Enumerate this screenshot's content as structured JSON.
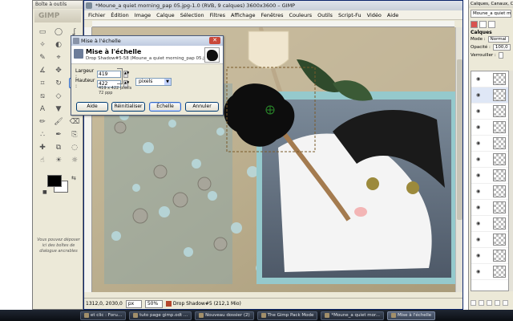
{
  "gimp": {
    "title": "*Moune_a quiet morning_pap 05.jpg-1.0 (RVB, 9 calques) 3600x3600 – GIMP",
    "menu": [
      "Fichier",
      "Édition",
      "Image",
      "Calque",
      "Sélection",
      "Filtres",
      "Affichage",
      "Fenêtres",
      "Couleurs",
      "Outils",
      "Script-Fu",
      "Vidéo",
      "Aide"
    ],
    "status": {
      "coords": "1312,0, 2030,0",
      "unit": "px",
      "zoom": "50%",
      "layer": "Drop Shadow#5 (212,1 Mio)"
    }
  },
  "toolbox": {
    "title": "Boîte à outils",
    "logo": "GIMP",
    "hint": "Vous pouvez déposer ici des boîtes de dialogue ancrables",
    "tools": [
      "rect-select-icon",
      "ellipse-select-icon",
      "lasso-icon",
      "magic-wand-icon",
      "select-by-color-icon",
      "scissors-icon",
      "paths-icon",
      "color-picker-icon",
      "zoom-icon",
      "measure-icon",
      "move-icon",
      "align-icon",
      "crop-icon",
      "rotate-icon",
      "scale-icon",
      "shear-icon",
      "perspective-icon",
      "flip-icon",
      "text-icon",
      "bucket-icon",
      "gradient-icon",
      "pencil-icon",
      "brush-icon",
      "eraser-icon",
      "airbrush-icon",
      "ink-icon",
      "clone-icon",
      "heal-icon",
      "perspective-clone-icon",
      "blur-icon",
      "smudge-icon",
      "dodge-icon",
      "dodge2-icon"
    ],
    "active_tool": "scale-icon",
    "fg_color": "#000000",
    "bg_color": "#ffffff"
  },
  "dialog": {
    "window_title": "Mise à l'échelle",
    "heading": "Mise à l'échelle",
    "subtitle": "Drop Shadow#5-58 (Moune_a quiet morning_pap 05.jpg)",
    "width_label": "Largeur :",
    "width_value": "419",
    "height_label": "Hauteur :",
    "height_value": "422",
    "unit": "pixels",
    "info_size": "419 x 422 pixels",
    "info_res": "72 ppp",
    "buttons": {
      "help": "Aide",
      "reset": "Réinitialiser",
      "scale": "Échelle",
      "cancel": "Annuler"
    }
  },
  "dock": {
    "title": "Calques, Canaux, Chemins",
    "image_selector": "Moune_a quiet morni...",
    "heading": "Calques",
    "mode_label": "Mode :",
    "mode_value": "Normal",
    "opacity_label": "Opacité :",
    "opacity_value": "100,0",
    "lock_label": "Verrouiller :",
    "layer_count": 13
  },
  "taskbar": {
    "items": [
      "et clic : Foru...",
      "tuto page gimp.odt ...",
      "Nouveau dossier (2)",
      "The Gimp Pack Mode",
      "*Moune_a quiet mor...",
      "Mise à l'échelle"
    ]
  }
}
